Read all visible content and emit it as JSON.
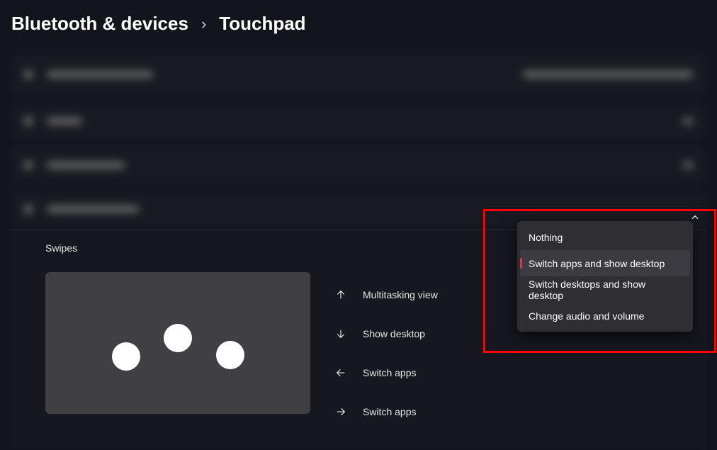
{
  "breadcrumb": {
    "parent": "Bluetooth & devices",
    "separator": "›",
    "current": "Touchpad"
  },
  "swipes": {
    "section_label": "Swipes",
    "actions": [
      {
        "dir": "up",
        "label": "Multitasking view"
      },
      {
        "dir": "down",
        "label": "Show desktop"
      },
      {
        "dir": "left",
        "label": "Switch apps"
      },
      {
        "dir": "right",
        "label": "Switch apps"
      }
    ]
  },
  "dropdown": {
    "options": [
      "Nothing",
      "Switch apps and show desktop",
      "Switch desktops and show desktop",
      "Change audio and volume"
    ],
    "selected_index": 1
  }
}
